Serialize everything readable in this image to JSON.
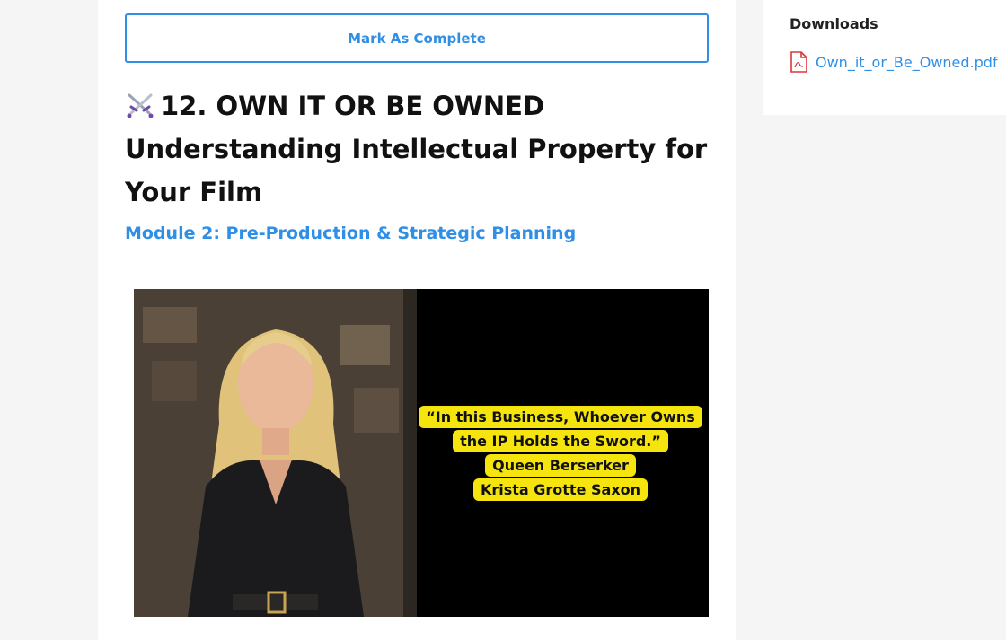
{
  "lesson": {
    "mark_complete_label": "Mark As Complete",
    "title_line1": "12. OWN IT OR BE OWNED",
    "title_line2": "Understanding Intellectual Property for Your Film",
    "title_icon": "crossed-swords-icon",
    "module_link": "Module 2: Pre-Production & Strategic Planning",
    "image": {
      "quote_lines": [
        "“In this Business, Whoever Owns",
        "the IP Holds the Sword.”",
        "Queen Berserker",
        "Krista Grotte Saxon"
      ]
    }
  },
  "sidebar": {
    "downloads_heading": "Downloads",
    "files": [
      {
        "name": "Own_it_or_Be_Owned.pdf",
        "icon": "pdf-file-icon"
      }
    ]
  },
  "colors": {
    "accent": "#2f8fe6",
    "highlight": "#f6e40f",
    "pdf_icon": "#d93838"
  }
}
